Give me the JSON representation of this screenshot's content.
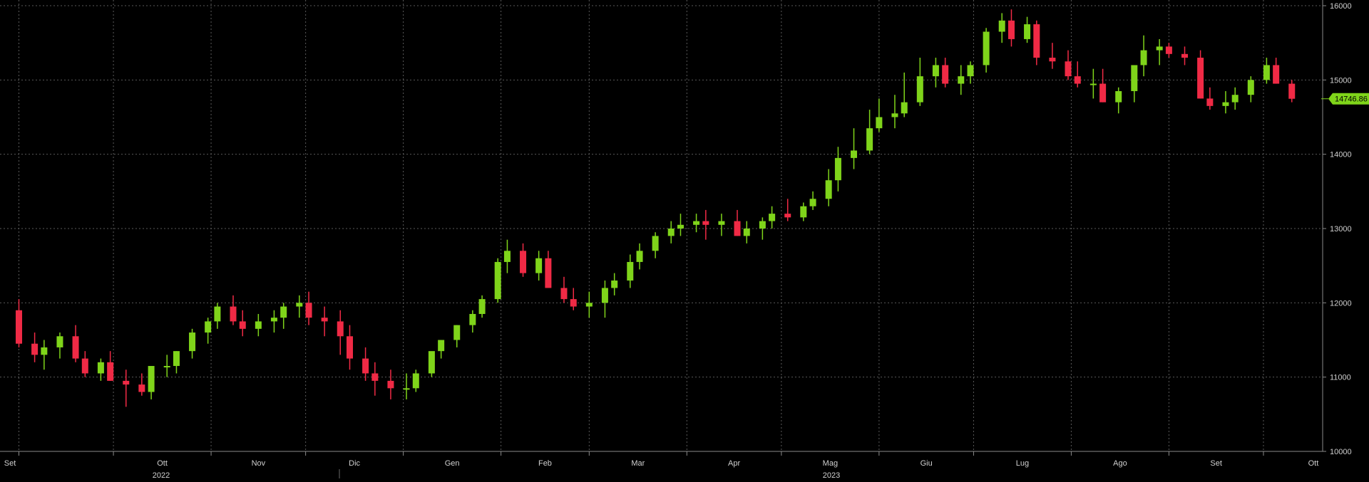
{
  "chart_data": {
    "type": "candlestick",
    "title": "",
    "xlabel": "",
    "ylabel": "",
    "ylim": [
      10000,
      16000
    ],
    "y_ticks": [
      "16000",
      "15000",
      "14000",
      "13000",
      "12000",
      "11000",
      "10000"
    ],
    "x_month_labels": [
      "Set",
      "Ott",
      "Nov",
      "Dic",
      "Gen",
      "Feb",
      "Mar",
      "Apr",
      "Mag",
      "Giu",
      "Lug",
      "Ago",
      "Set",
      "Ott"
    ],
    "x_year_labels": [
      "2022",
      "2023"
    ],
    "grid": true,
    "up_color": "#7fd41a",
    "down_color": "#f02a45",
    "last_value": "14746.86",
    "x": [
      "2022-09-01",
      "2022-09-06",
      "2022-09-09",
      "2022-09-14",
      "2022-09-19",
      "2022-09-22",
      "2022-09-27",
      "2022-09-30",
      "2022-10-05",
      "2022-10-10",
      "2022-10-13",
      "2022-10-18",
      "2022-10-21",
      "2022-10-26",
      "2022-10-31",
      "2022-11-03",
      "2022-11-08",
      "2022-11-11",
      "2022-11-16",
      "2022-11-21",
      "2022-11-24",
      "2022-11-29",
      "2022-12-02",
      "2022-12-07",
      "2022-12-12",
      "2022-12-15",
      "2022-12-20",
      "2022-12-23",
      "2022-12-28",
      "2023-01-02",
      "2023-01-05",
      "2023-01-10",
      "2023-01-13",
      "2023-01-18",
      "2023-01-23",
      "2023-01-26",
      "2023-01-31",
      "2023-02-03",
      "2023-02-08",
      "2023-02-13",
      "2023-02-16",
      "2023-02-21",
      "2023-02-24",
      "2023-03-01",
      "2023-03-06",
      "2023-03-09",
      "2023-03-14",
      "2023-03-17",
      "2023-03-22",
      "2023-03-27",
      "2023-03-30",
      "2023-04-04",
      "2023-04-07",
      "2023-04-12",
      "2023-04-17",
      "2023-04-20",
      "2023-04-25",
      "2023-04-28",
      "2023-05-03",
      "2023-05-08",
      "2023-05-11",
      "2023-05-16",
      "2023-05-19",
      "2023-05-24",
      "2023-05-29",
      "2023-06-01",
      "2023-06-06",
      "2023-06-09",
      "2023-06-14",
      "2023-06-19",
      "2023-06-22",
      "2023-06-27",
      "2023-06-30",
      "2023-07-05",
      "2023-07-10",
      "2023-07-13",
      "2023-07-18",
      "2023-07-21",
      "2023-07-26",
      "2023-07-31",
      "2023-08-03",
      "2023-08-08",
      "2023-08-11",
      "2023-08-16",
      "2023-08-21",
      "2023-08-24",
      "2023-08-29",
      "2023-09-01",
      "2023-09-06",
      "2023-09-11",
      "2023-09-14",
      "2023-09-19",
      "2023-09-22",
      "2023-09-27",
      "2023-10-02",
      "2023-10-05",
      "2023-10-10"
    ],
    "series": [
      {
        "open": [
          11900,
          11450,
          11300,
          11400,
          11550,
          11250,
          11050,
          11200,
          10950,
          10900,
          10800,
          11150,
          11150,
          11350,
          11600,
          11750,
          11950,
          11750,
          11650,
          11750,
          11800,
          11950,
          12000,
          11800,
          11750,
          11550,
          11250,
          11050,
          10950,
          10850,
          10850,
          11050,
          11350,
          11500,
          11700,
          11850,
          12050,
          12550,
          12700,
          12400,
          12600,
          12200,
          12050,
          11950,
          12000,
          12200,
          12300,
          12550,
          12700,
          12900,
          13000,
          13050,
          13100,
          13050,
          13100,
          12900,
          13000,
          13100,
          13200,
          13150,
          13300,
          13400,
          13650,
          13950,
          14050,
          14350,
          14500,
          14550,
          14700,
          15050,
          15200,
          14950,
          15050,
          15200,
          15650,
          15800,
          15550,
          15750,
          15300,
          15250,
          15050,
          14950,
          14950,
          14700,
          14850,
          15200,
          15400,
          15450,
          15350,
          15300,
          14750,
          14650,
          14700,
          14800,
          15000,
          15200,
          14950
        ],
        "high": [
          12050,
          11600,
          11500,
          11600,
          11700,
          11350,
          11250,
          11350,
          11100,
          11050,
          11000,
          11300,
          11350,
          11650,
          11800,
          12000,
          12100,
          11900,
          11850,
          11900,
          12000,
          12100,
          12150,
          11950,
          11900,
          11700,
          11400,
          11200,
          11100,
          11050,
          11100,
          11300,
          11500,
          11700,
          11900,
          12100,
          12600,
          12850,
          12800,
          12700,
          12700,
          12350,
          12200,
          12150,
          12300,
          12400,
          12650,
          12800,
          12950,
          13100,
          13200,
          13200,
          13250,
          13200,
          13250,
          13100,
          13150,
          13300,
          13400,
          13350,
          13500,
          13800,
          14100,
          14350,
          14600,
          14750,
          14800,
          15100,
          15300,
          15300,
          15300,
          15200,
          15250,
          15700,
          15900,
          15950,
          15850,
          15800,
          15500,
          15400,
          15250,
          15150,
          15150,
          14900,
          15150,
          15600,
          15550,
          15500,
          15450,
          15400,
          14900,
          14850,
          14900,
          15050,
          15300,
          15300,
          15000
        ],
        "low": [
          11400,
          11200,
          11100,
          11250,
          11200,
          11000,
          10950,
          10950,
          10600,
          10750,
          10700,
          11000,
          11050,
          11250,
          11450,
          11650,
          11700,
          11550,
          11550,
          11600,
          11650,
          11800,
          11700,
          11550,
          11300,
          11100,
          10950,
          10750,
          10700,
          10700,
          10800,
          11000,
          11250,
          11400,
          11600,
          11800,
          12000,
          12400,
          12350,
          12300,
          12200,
          12000,
          11900,
          11800,
          11800,
          12100,
          12200,
          12450,
          12600,
          12800,
          12900,
          12950,
          12850,
          12900,
          12900,
          12800,
          12850,
          13000,
          13100,
          13100,
          13250,
          13300,
          13500,
          13800,
          14000,
          14300,
          14350,
          14500,
          14650,
          14900,
          14900,
          14800,
          14950,
          15100,
          15500,
          15450,
          15500,
          15200,
          15150,
          15000,
          14900,
          14750,
          14700,
          14550,
          14700,
          15050,
          15200,
          15300,
          15200,
          14750,
          14600,
          14550,
          14600,
          14700,
          14950,
          14950,
          14700
        ],
        "close": [
          11450,
          11300,
          11400,
          11550,
          11250,
          11050,
          11200,
          10950,
          10900,
          10800,
          11150,
          11150,
          11350,
          11600,
          11750,
          11950,
          11750,
          11650,
          11750,
          11800,
          11950,
          12000,
          11800,
          11750,
          11550,
          11250,
          11050,
          10950,
          10850,
          10850,
          11050,
          11350,
          11500,
          11700,
          11850,
          12050,
          12550,
          12700,
          12400,
          12600,
          12200,
          12050,
          11950,
          12000,
          12200,
          12300,
          12550,
          12700,
          12900,
          13000,
          13050,
          13100,
          13050,
          13100,
          12900,
          13000,
          13100,
          13200,
          13150,
          13300,
          13400,
          13650,
          13950,
          14050,
          14350,
          14500,
          14550,
          14700,
          15050,
          15200,
          14950,
          15050,
          15200,
          15650,
          15800,
          15550,
          15750,
          15300,
          15250,
          15050,
          14950,
          14950,
          14700,
          14850,
          15200,
          15400,
          15450,
          15350,
          15300,
          14750,
          14650,
          14700,
          14800,
          15000,
          15200,
          14950,
          14747
        ]
      }
    ]
  }
}
